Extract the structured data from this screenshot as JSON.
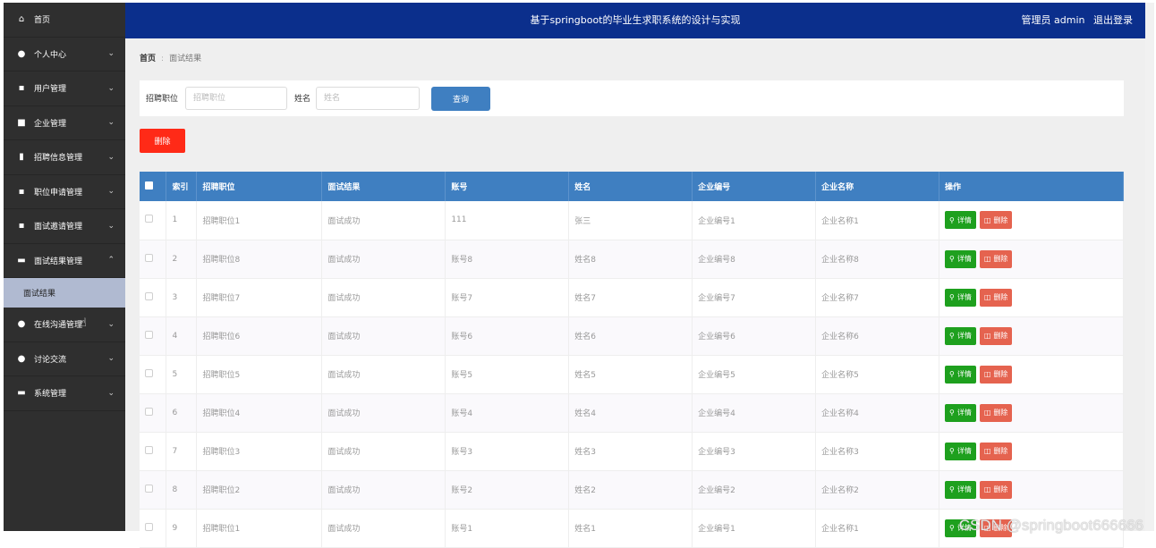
{
  "sidebar": {
    "items": [
      {
        "label": "首页",
        "icon": "home-icon",
        "glyph": "⌂",
        "chevron": ""
      },
      {
        "label": "个人中心",
        "icon": "user-icon",
        "glyph": "●",
        "chevron": "⌄"
      },
      {
        "label": "用户管理",
        "icon": "grid-icon",
        "glyph": "▪",
        "chevron": "⌄"
      },
      {
        "label": "企业管理",
        "icon": "briefcase-icon",
        "glyph": "■",
        "chevron": "⌄"
      },
      {
        "label": "招聘信息管理",
        "icon": "clipboard-icon",
        "glyph": "▮",
        "chevron": "⌄"
      },
      {
        "label": "职位申请管理",
        "icon": "grid-icon",
        "glyph": "▪",
        "chevron": "⌄"
      },
      {
        "label": "面试邀请管理",
        "icon": "grid-icon",
        "glyph": "▪",
        "chevron": "⌄"
      },
      {
        "label": "面试结果管理",
        "icon": "card-icon",
        "glyph": "▬",
        "chevron": "⌃"
      }
    ],
    "sub_active": "面试结果",
    "items_after": [
      {
        "label": "在线沟通管理",
        "icon": "location-pin-icon",
        "glyph": "●",
        "chevron": "⌄"
      },
      {
        "label": "讨论交流",
        "icon": "user-icon",
        "glyph": "●",
        "chevron": "⌄"
      },
      {
        "label": "系统管理",
        "icon": "monitor-icon",
        "glyph": "▬",
        "chevron": "⌄"
      }
    ]
  },
  "header": {
    "title": "基于springboot的毕业生求职系统的设计与实现",
    "role": "管理员 admin",
    "logout": "退出登录"
  },
  "breadcrumb": {
    "home": "首页",
    "separator": ":",
    "current": "面试结果"
  },
  "search": {
    "position_label": "招聘职位",
    "position_placeholder": "招聘职位",
    "name_label": "姓名",
    "name_placeholder": "姓名",
    "button": "查询"
  },
  "toolbar": {
    "delete_label": "删除"
  },
  "table": {
    "columns": [
      "索引",
      "招聘职位",
      "面试结果",
      "账号",
      "姓名",
      "企业编号",
      "企业名称",
      "操作"
    ],
    "rows": [
      [
        "1",
        "招聘职位1",
        "面试成功",
        "111",
        "张三",
        "企业编号1",
        "企业名称1"
      ],
      [
        "2",
        "招聘职位8",
        "面试成功",
        "账号8",
        "姓名8",
        "企业编号8",
        "企业名称8"
      ],
      [
        "3",
        "招聘职位7",
        "面试成功",
        "账号7",
        "姓名7",
        "企业编号7",
        "企业名称7"
      ],
      [
        "4",
        "招聘职位6",
        "面试成功",
        "账号6",
        "姓名6",
        "企业编号6",
        "企业名称6"
      ],
      [
        "5",
        "招聘职位5",
        "面试成功",
        "账号5",
        "姓名5",
        "企业编号5",
        "企业名称5"
      ],
      [
        "6",
        "招聘职位4",
        "面试成功",
        "账号4",
        "姓名4",
        "企业编号4",
        "企业名称4"
      ],
      [
        "7",
        "招聘职位3",
        "面试成功",
        "账号3",
        "姓名3",
        "企业编号3",
        "企业名称3"
      ],
      [
        "8",
        "招聘职位2",
        "面试成功",
        "账号2",
        "姓名2",
        "企业编号2",
        "企业名称2"
      ],
      [
        "9",
        "招聘职位1",
        "面试成功",
        "账号1",
        "姓名1",
        "企业编号1",
        "企业名称1"
      ]
    ],
    "detail_label": "详情",
    "delete_label": "删除"
  },
  "watermark": "CSDN @springboot666666",
  "colors": {
    "header_bg": "#0b2f8c",
    "sidebar_bg": "#2f2f2f",
    "table_header": "#3f7fc1",
    "detail_button": "#1ea01e",
    "delete_button": "#e5634f",
    "primary_delete": "#ff2a17"
  }
}
